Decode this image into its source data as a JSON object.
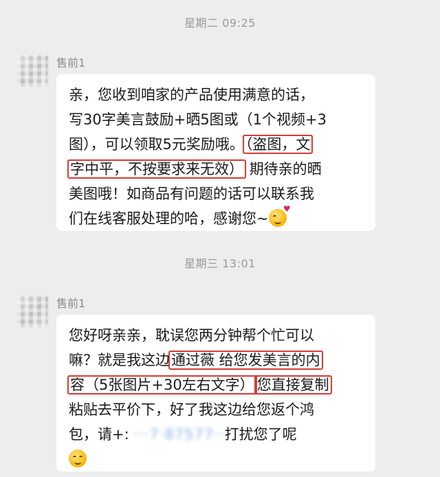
{
  "chat": {
    "timestamps": [
      "星期二 09:25",
      "星期三 13:01"
    ],
    "messages": [
      {
        "sender": "售前1",
        "lines": [
          "亲，您收到咱家的产品使用满意的话，",
          "写30字美言鼓励+晒5图或（1个视频+3",
          "图），可以领取5元奖励哦。",
          "（盗图，文",
          "字中平，不按要求来无效）",
          "期待亲的晒",
          "美图哦！如商品有问题的话可以联系我",
          "们在线客服处理的哈，感谢您~"
        ],
        "emoji": "blushing-kiss-emoji"
      },
      {
        "sender": "售前1",
        "lines": [
          "您好呀亲亲，耽误您两分钟帮个忙可以",
          "嘛？就是我这边",
          "通过薇 给您发美言的内",
          "容（5张图片+30左右文字）",
          "您直接复制",
          "粘贴去平价下，好了我这边给您返个鸿",
          "包，请+:",
          "打扰您了呢"
        ],
        "emoji": "laughing-emoji"
      }
    ],
    "highlight_color": "#d43b35"
  }
}
